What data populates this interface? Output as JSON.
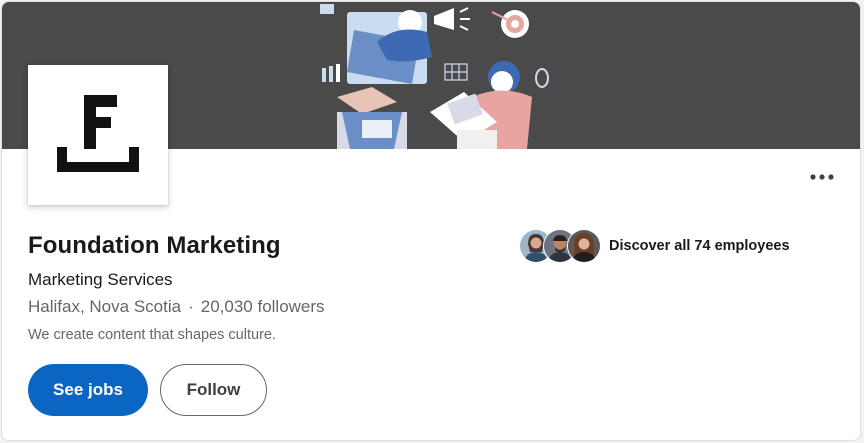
{
  "company": {
    "name": "Foundation Marketing",
    "industry": "Marketing Services",
    "location": "Halifax, Nova Scotia",
    "separator": "·",
    "followers": "20,030 followers",
    "tagline": "We create content that shapes culture."
  },
  "actions": {
    "primary_label": "See jobs",
    "secondary_label": "Follow"
  },
  "employees": {
    "label": "Discover all 74 employees",
    "avatars": [
      "employee-avatar",
      "employee-avatar",
      "employee-avatar"
    ]
  },
  "icons": {
    "overflow": "more-horizontal-icon",
    "logo": "foundation-logo"
  },
  "colors": {
    "primary": "#0a66c2",
    "cover_bg": "#4a4a4b",
    "text": "#191919",
    "muted": "#666666"
  }
}
